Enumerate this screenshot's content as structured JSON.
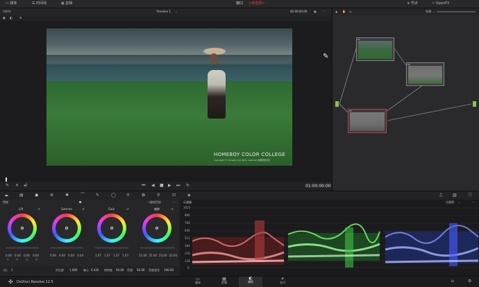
{
  "topbar": {
    "left": [
      {
        "icon": "media-icon",
        "label": "媒体"
      },
      {
        "icon": "timeline-icon",
        "label": "时间线"
      },
      {
        "icon": "clips-icon",
        "label": "剪辑"
      }
    ],
    "center_label": "窗口",
    "center_red": "<未选择>",
    "right": [
      {
        "icon": "share-icon",
        "label": "节点"
      },
      {
        "icon": "openfx-icon",
        "label": "OpenFX"
      }
    ]
  },
  "viewer": {
    "zoom": "106%",
    "timeline": "Timeline 1",
    "timecode": "00:00:00:00",
    "playhead_tc": "01:00:00:00",
    "watermark_title": "HOMEBOY COLOR COLLEGE",
    "watermark_sub": "Copyright © Homeboy all rights reserved 中国调色文化"
  },
  "nodes_panel": {
    "mode": "剪辑",
    "nodes": [
      {
        "id": "01"
      },
      {
        "id": "02"
      },
      {
        "id": "03"
      }
    ]
  },
  "color_panel": {
    "title": "色轮",
    "mode_label": "一级校色轮",
    "wheels": [
      {
        "label": "Lift",
        "values": [
          "0.00",
          "0.00",
          "0.00",
          "0.00"
        ]
      },
      {
        "label": "Gamma",
        "values": [
          "0.00",
          "0.04",
          "0.04",
          "0.04"
        ]
      },
      {
        "label": "Gain",
        "values": [
          "1.07",
          "1.07",
          "1.07",
          "1.07"
        ]
      },
      {
        "label": "偏移",
        "values": [
          "25.00",
          "25.00",
          "25.00",
          "25.00"
        ]
      }
    ],
    "channel_labels": [
      "Y",
      "R",
      "G",
      "B"
    ],
    "bottom_params": [
      {
        "label": "对比度",
        "value": "1.000"
      },
      {
        "label": "轴心",
        "value": "0.435"
      },
      {
        "label": "饱和度",
        "value": "50.00"
      },
      {
        "label": "色相",
        "value": "50.00"
      },
      {
        "label": "亮度混合",
        "value": "100.00"
      }
    ],
    "page_nums": [
      "1",
      "2"
    ]
  },
  "scopes": {
    "title": "示波器",
    "mode": "分量图",
    "scale": [
      "1023",
      "896",
      "768",
      "640",
      "512",
      "384",
      "256",
      "128",
      "0"
    ]
  },
  "footer": {
    "app": "DaVinci Resolve 12.5",
    "pages": [
      {
        "icon": "media-page-icon",
        "label": "媒体"
      },
      {
        "icon": "edit-page-icon",
        "label": "剪辑"
      },
      {
        "icon": "color-page-icon",
        "label": "调色"
      },
      {
        "icon": "deliver-page-icon",
        "label": "交付"
      }
    ]
  },
  "colors": {
    "accent": "#e23a3a",
    "node_green": "#9ad24a",
    "active_page": "#d8d8d8"
  }
}
